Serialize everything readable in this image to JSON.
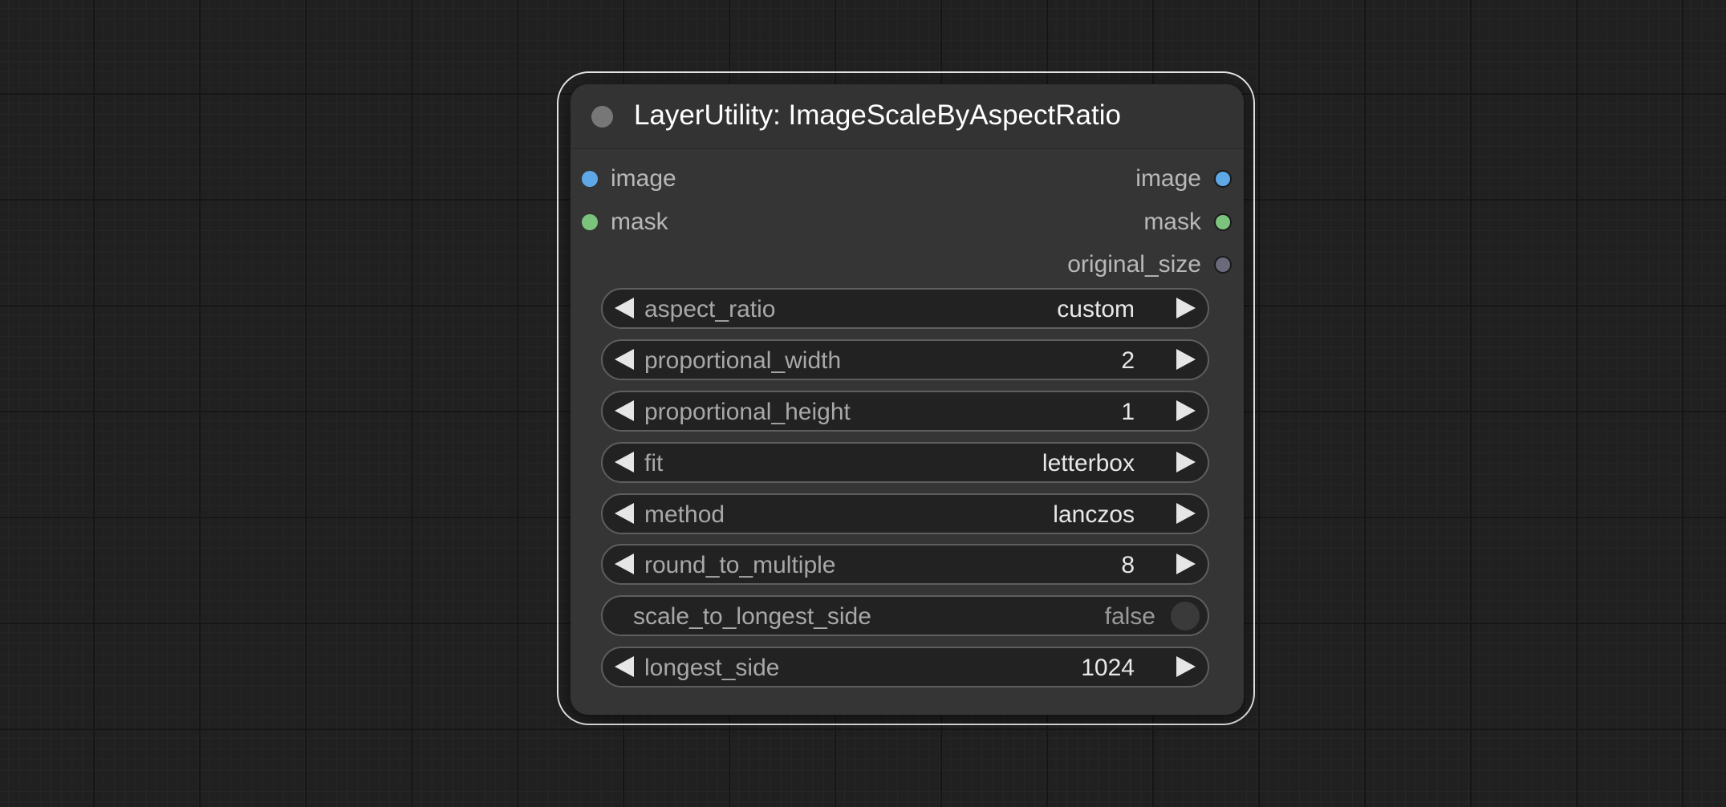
{
  "node": {
    "title": "LayerUtility: ImageScaleByAspectRatio",
    "inputs": [
      {
        "label": "image",
        "color": "#5fa8e8"
      },
      {
        "label": "mask",
        "color": "#7cc47d"
      }
    ],
    "outputs": [
      {
        "label": "image",
        "color": "#5fa8e8"
      },
      {
        "label": "mask",
        "color": "#7cc47d"
      },
      {
        "label": "original_size",
        "color": "#6a6a7c"
      }
    ],
    "widgets": {
      "aspect_ratio": {
        "label": "aspect_ratio",
        "value": "custom"
      },
      "proportional_width": {
        "label": "proportional_width",
        "value": "2"
      },
      "proportional_height": {
        "label": "proportional_height",
        "value": "1"
      },
      "fit": {
        "label": "fit",
        "value": "letterbox"
      },
      "method": {
        "label": "method",
        "value": "lanczos"
      },
      "round_to_multiple": {
        "label": "round_to_multiple",
        "value": "8"
      },
      "scale_to_longest_side": {
        "label": "scale_to_longest_side",
        "value": "false"
      },
      "longest_side": {
        "label": "longest_side",
        "value": "1024"
      }
    }
  },
  "icons": {
    "collapse": "circle-dot-icon",
    "decrement": "arrow-left-icon",
    "increment": "arrow-right-icon",
    "toggle": "toggle-knob-icon"
  },
  "colors": {
    "canvas_bg": "#202020",
    "node_bg": "#353535",
    "selection_outline": "#e6e6e6",
    "widget_bg": "#222222"
  }
}
